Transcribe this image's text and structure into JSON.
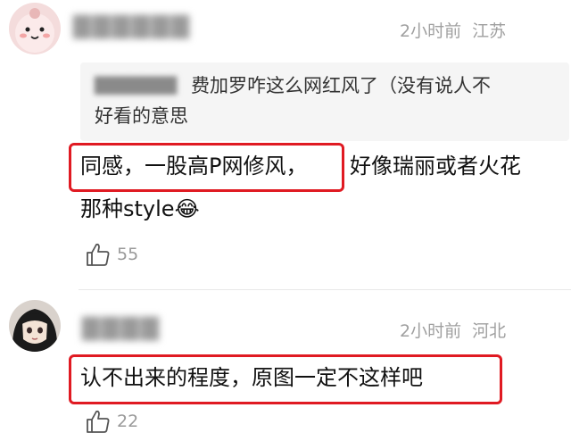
{
  "comments": [
    {
      "username": "▇▇▇▇▇▇",
      "time": "2小时前",
      "location": "江苏",
      "quote": {
        "username": "▇▇▇▇▇▇",
        "line1": "费加罗咋这么网红风了（没有说人不",
        "line2": "好看的意思"
      },
      "highlight_text": "同感，一股高P网修风，",
      "text_after_highlight": "好像瑞丽或者火花",
      "line2_text": "那种style",
      "emoji": "😂",
      "likes": "55"
    },
    {
      "username": "▇▇▇▇",
      "time": "2小时前",
      "location": "河北",
      "highlight_text": "认不出来的程度，原图一定不这样吧",
      "likes": "22"
    }
  ],
  "colors": {
    "highlight_border": "#e01a22",
    "meta": "#a0a0a0",
    "quote_bg": "#f5f5f5"
  }
}
